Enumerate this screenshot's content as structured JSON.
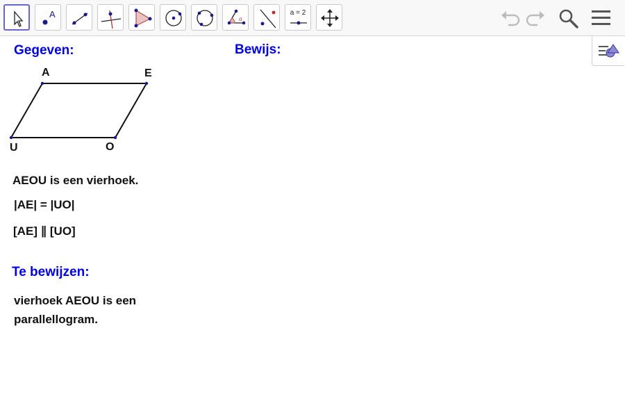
{
  "toolbar": {
    "tools": [
      {
        "name": "move-tool",
        "selected": true
      },
      {
        "name": "point-tool"
      },
      {
        "name": "segment-tool"
      },
      {
        "name": "perpendicular-line-tool"
      },
      {
        "name": "polygon-tool"
      },
      {
        "name": "circle-center-point-tool"
      },
      {
        "name": "circle-three-points-tool"
      },
      {
        "name": "angle-tool"
      },
      {
        "name": "reflect-about-line-tool"
      },
      {
        "name": "slider-tool",
        "label": "a = 2"
      },
      {
        "name": "move-graphics-view-tool"
      }
    ],
    "header_buttons": [
      "undo-icon",
      "redo-icon",
      "search-icon",
      "menu-icon"
    ]
  },
  "style_bar_icon": "style-bar-toggle-icon",
  "canvas": {
    "given_title": "Gegeven:",
    "proof_title": "Bewijs:",
    "figure": {
      "points": {
        "A": "A",
        "E": "E",
        "O": "O",
        "U": "U"
      }
    },
    "given_lines": [
      "AEOU is een vierhoek.",
      "|AE| = |UO|",
      "[AE] ∥ [UO]"
    ],
    "to_prove_title": "Te bewijzen:",
    "to_prove_lines": [
      "vierhoek AEOU is een",
      "parallellogram."
    ]
  },
  "colors": {
    "heading": "#0000ee",
    "text": "#111111",
    "selected_tool_border": "#6666cc",
    "point": "#1a1a8c"
  }
}
